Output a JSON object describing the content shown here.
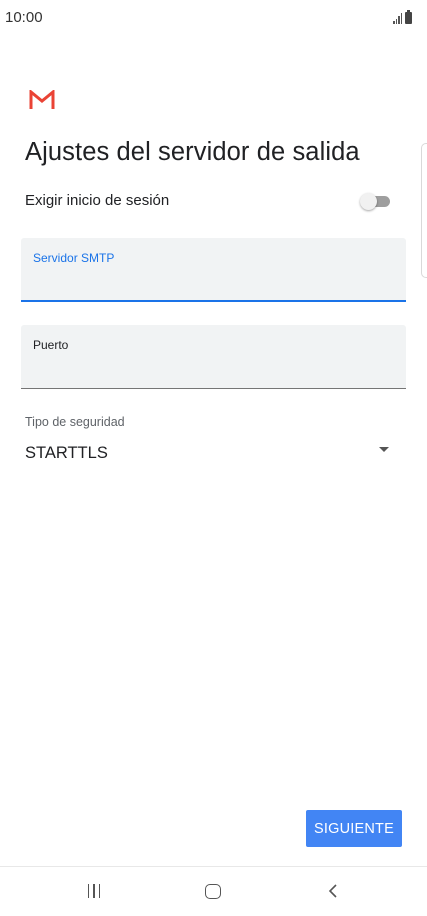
{
  "status_bar": {
    "time": "10:00",
    "signal_icon": "signal-icon",
    "battery_icon": "battery-icon"
  },
  "app": {
    "logo": "gmail-logo",
    "colors": {
      "accent": "#1a73e8",
      "button": "#4285f4",
      "logo_red": "#ea4335"
    }
  },
  "page": {
    "title": "Ajustes del servidor de salida"
  },
  "login": {
    "label": "Exigir inicio de sesión",
    "enabled": false
  },
  "smtp": {
    "label": "Servidor SMTP",
    "value": ""
  },
  "port": {
    "label": "Puerto",
    "value": ""
  },
  "security": {
    "label": "Tipo de seguridad",
    "value": "STARTTLS"
  },
  "actions": {
    "next_label": "SIGUIENTE"
  },
  "nav_bar": {
    "recents_icon": "recents-icon",
    "home_icon": "home-icon",
    "back_icon": "back-icon"
  }
}
